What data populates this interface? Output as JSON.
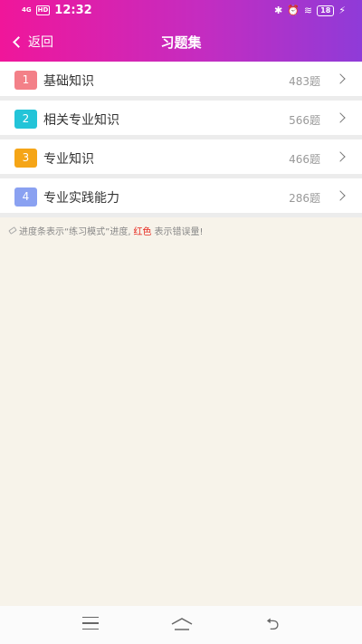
{
  "status_bar": {
    "signal": "4G",
    "hd": "HD",
    "time": "12:32",
    "battery": "18"
  },
  "navbar": {
    "back_label": "返回",
    "title": "习题集"
  },
  "rows": [
    {
      "num": "1",
      "label": "基础知识",
      "count": "483题",
      "color": "#f38088"
    },
    {
      "num": "2",
      "label": "相关专业知识",
      "count": "566题",
      "color": "#23c4d8"
    },
    {
      "num": "3",
      "label": "专业知识",
      "count": "466题",
      "color": "#f5a517"
    },
    {
      "num": "4",
      "label": "专业实践能力",
      "count": "286题",
      "color": "#8aa1f1"
    }
  ],
  "note": {
    "prefix": "进度条表示“练习模式”进度,",
    "highlight": "红色",
    "suffix": "表示错误量!"
  },
  "colors": {
    "header_gradient_start": "#f0169a",
    "header_gradient_end": "#8f3bd8",
    "background": "#f7f3ea"
  },
  "bottom_nav": {
    "icons": [
      "menu-icon",
      "home-icon",
      "back-icon"
    ]
  }
}
